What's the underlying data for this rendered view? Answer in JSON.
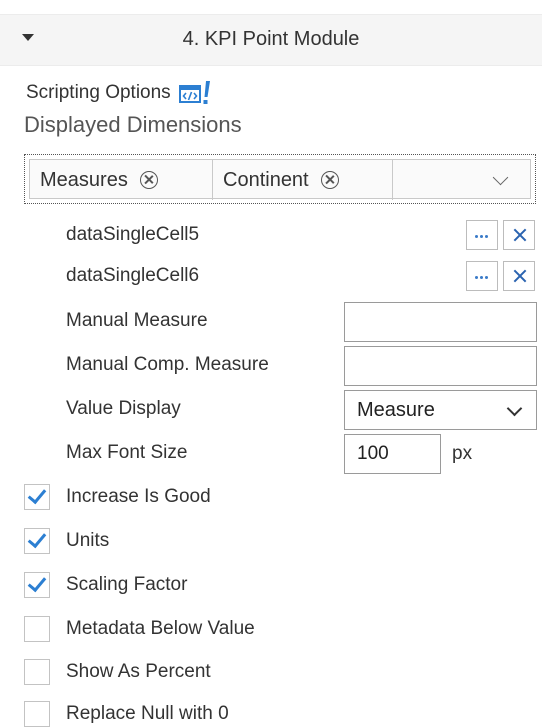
{
  "module": {
    "title": "4. KPI Point Module"
  },
  "scripting": {
    "label": "Scripting Options",
    "icon": "script-edit-icon"
  },
  "dimensions": {
    "section_title": "Displayed Dimensions",
    "tokens": [
      "Measures",
      "Continent"
    ]
  },
  "cells": [
    {
      "label": "dataSingleCell5"
    },
    {
      "label": "dataSingleCell6"
    }
  ],
  "fields": {
    "manual_measure": {
      "label": "Manual Measure",
      "value": ""
    },
    "manual_comp_measure": {
      "label": "Manual Comp. Measure",
      "value": ""
    },
    "value_display": {
      "label": "Value Display",
      "value": "Measure"
    },
    "max_font_size": {
      "label": "Max Font Size",
      "value": "100",
      "unit": "px"
    }
  },
  "options": [
    {
      "label": "Increase Is Good",
      "checked": true
    },
    {
      "label": "Units",
      "checked": true
    },
    {
      "label": "Scaling Factor",
      "checked": true
    },
    {
      "label": "Metadata Below Value",
      "checked": false
    },
    {
      "label": "Show As Percent",
      "checked": false
    },
    {
      "label": "Replace Null with 0",
      "checked": false
    }
  ],
  "colors": {
    "accent": "#2c7fd2",
    "header_bg": "#f5f5f5"
  }
}
